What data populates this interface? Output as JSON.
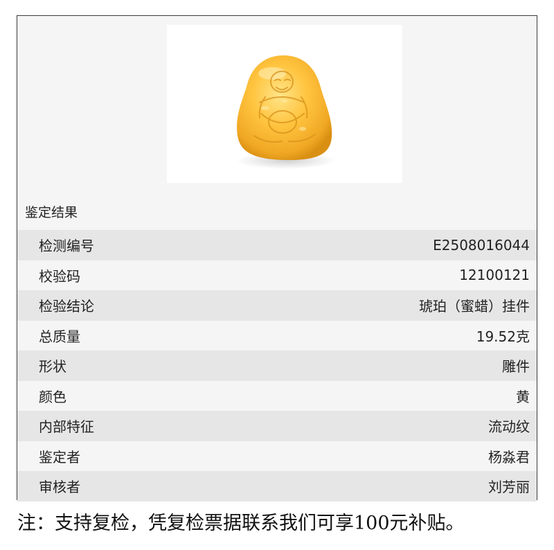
{
  "photo": {
    "icon": "amber-buddha-pendant",
    "colors": {
      "amber_light": "#ffd45a",
      "amber": "#f5b731",
      "amber_dark": "#d98f12"
    }
  },
  "result": {
    "section_title": "鉴定结果",
    "rows": [
      {
        "label": "检测编号",
        "value": "E2508016044"
      },
      {
        "label": "校验码",
        "value": "12100121"
      },
      {
        "label": "检验结论",
        "value": "琥珀（蜜蜡）挂件"
      },
      {
        "label": "总质量",
        "value": "19.52克"
      },
      {
        "label": "形状",
        "value": "雕件"
      },
      {
        "label": "颜色",
        "value": "黄"
      },
      {
        "label": "内部特征",
        "value": "流动纹"
      },
      {
        "label": "鉴定者",
        "value": "杨淼君"
      },
      {
        "label": "审核者",
        "value": "刘芳丽"
      }
    ]
  },
  "footer": {
    "note": "注：支持复检，凭复检票据联系我们可享100元补贴。"
  }
}
